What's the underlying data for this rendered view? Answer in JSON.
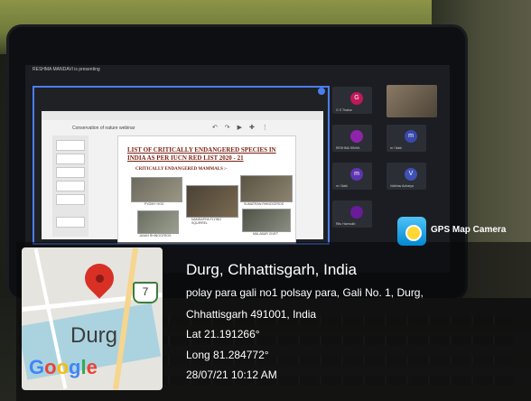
{
  "photo": {
    "presenter_text": "RESHMA MANDAVI is presenting",
    "slides_app_title": "Conservation of nature webinar",
    "slides_toolbar": "↶ ↷ ▶ ✚ ⋮",
    "slide_title": "LIST OF CRITICALLY ENDANGERED SPECIES IN INDIA AS PER IUCN RED LIST 2020 - 21",
    "slide_subtitle": "CRITICALLY ENDANGERED MAMMALS :-",
    "animal_labels": [
      "PYGMY HOG",
      "NAMDAPHA FLYING SQUIRREL",
      "SUMATRAN RHINOCEROS",
      "JAVAN RHINOCEROS",
      "MALABAR CIVET"
    ],
    "participants": [
      {
        "name": "G S Thakur",
        "initial": "G",
        "color": "#c2185b"
      },
      {
        "name": "RESHMA SINHA",
        "initial": "",
        "color": "#8e24aa"
      },
      {
        "name": "m I Naik",
        "initial": "m",
        "color": "#3949ab"
      },
      {
        "name": "m I Naik",
        "initial": "m",
        "color": "#5e35b1"
      },
      {
        "name": "Vaibhav Acharya",
        "initial": "V",
        "color": "#3f51b5"
      },
      {
        "name": "Ritu Harmukh",
        "initial": "",
        "color": "#6a1b9a"
      }
    ]
  },
  "gps": {
    "app_label": "GPS Map Camera",
    "map_city": "Durg",
    "map_route_number": "7",
    "google_letters": [
      "G",
      "o",
      "o",
      "g",
      "l",
      "e"
    ],
    "location_title": "Durg, Chhattisgarh, India",
    "address_line1": "polay para gali no1 polsay para, Gali No. 1, Durg,",
    "address_line2": "Chhattisgarh 491001, India",
    "lat": "Lat 21.191266°",
    "long": "Long 81.284772°",
    "datetime": "28/07/21 10:12 AM"
  },
  "colors": {
    "pin": "#d93025",
    "google_blue": "#4285f4",
    "google_red": "#ea4335",
    "google_yellow": "#fbbc05",
    "google_green": "#34a853",
    "share_border": "#4a7ef0",
    "slide_title": "#7a1f10"
  }
}
